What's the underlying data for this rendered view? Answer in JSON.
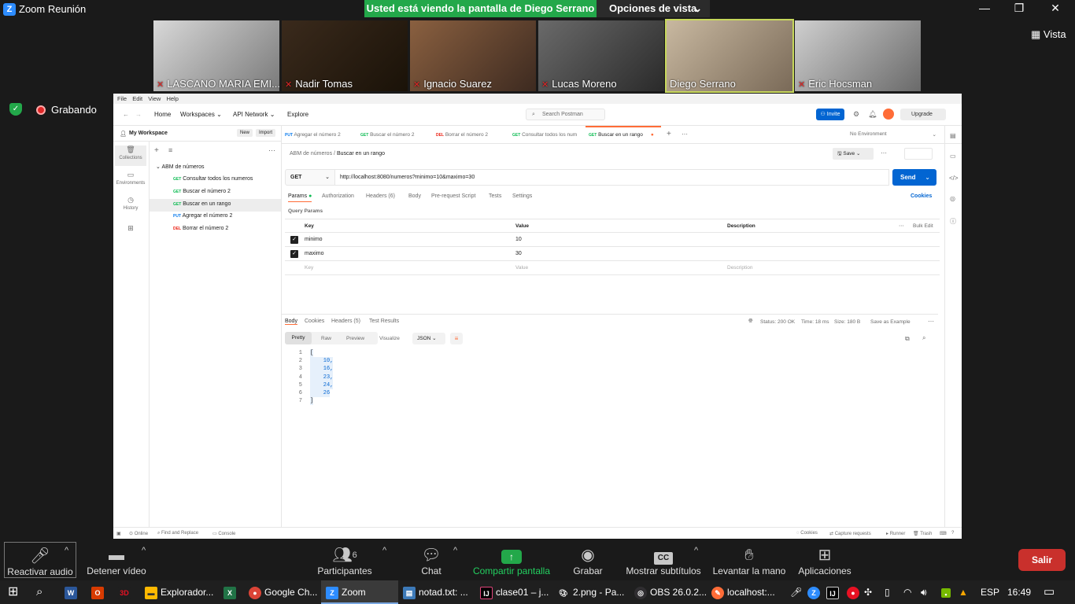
{
  "zoom": {
    "title": "Zoom Reunión",
    "banner": "Usted está viendo la pantalla de Diego Serrano",
    "view_options": "Opciones de vista",
    "vista": "Vista",
    "recording": "Grabando",
    "participants": [
      {
        "name": "LASCANO MARIA EMI...",
        "muted": true
      },
      {
        "name": "Nadir Tomas",
        "muted": true
      },
      {
        "name": "Ignacio Suarez",
        "muted": true
      },
      {
        "name": "Lucas Moreno",
        "muted": true
      },
      {
        "name": "Diego Serrano",
        "muted": false
      },
      {
        "name": "Eric Hocsman",
        "muted": true
      }
    ],
    "bottom": {
      "audio": "Reactivar audio",
      "video": "Detener vídeo",
      "participants": "Participantes",
      "participants_count": "6",
      "chat": "Chat",
      "share": "Compartir pantalla",
      "record": "Grabar",
      "subtitles": "Mostrar subtítulos",
      "hand": "Levantar la mano",
      "apps": "Aplicaciones",
      "leave": "Salir"
    }
  },
  "postman": {
    "menu": [
      "File",
      "Edit",
      "View",
      "Help"
    ],
    "nav": {
      "home": "Home",
      "workspaces": "Workspaces",
      "api_network": "API Network",
      "explore": "Explore"
    },
    "search_placeholder": "Search Postman",
    "invite": "Invite",
    "upgrade": "Upgrade",
    "workspace": "My Workspace",
    "new_btn": "New",
    "import_btn": "Import",
    "rail": [
      "Collections",
      "Environments",
      "History"
    ],
    "collection": "ABM de números",
    "requests": [
      {
        "method": "GET",
        "name": "Consultar todos los numeros"
      },
      {
        "method": "GET",
        "name": "Buscar el número 2"
      },
      {
        "method": "GET",
        "name": "Buscar en un rango"
      },
      {
        "method": "PUT",
        "name": "Agregar el número 2"
      },
      {
        "method": "DEL",
        "name": "Borrar el número 2"
      }
    ],
    "tabs": [
      {
        "method": "PUT",
        "name": "Agregar el número 2"
      },
      {
        "method": "GET",
        "name": "Buscar el número 2"
      },
      {
        "method": "DEL",
        "name": "Borrar el número 2"
      },
      {
        "method": "GET",
        "name": "Consultar todos los num"
      },
      {
        "method": "GET",
        "name": "Buscar en un rango"
      }
    ],
    "environment": "No Environment",
    "breadcrumb_parent": "ABM de números",
    "breadcrumb_current": "Buscar en un rango",
    "save": "Save",
    "method": "GET",
    "url": "http://localhost:8080/numeros?minimo=10&maximo=30",
    "send": "Send",
    "req_tabs": [
      "Params",
      "Authorization",
      "Headers (6)",
      "Body",
      "Pre-request Script",
      "Tests",
      "Settings"
    ],
    "cookies": "Cookies",
    "query_params": "Query Params",
    "col_key": "Key",
    "col_value": "Value",
    "col_desc": "Description",
    "bulk_edit": "Bulk Edit",
    "params": [
      {
        "key": "minimo",
        "value": "10"
      },
      {
        "key": "maximo",
        "value": "30"
      }
    ],
    "placeholder_key": "Key",
    "placeholder_value": "Value",
    "placeholder_desc": "Description",
    "resp_tabs": [
      "Body",
      "Cookies",
      "Headers (5)",
      "Test Results"
    ],
    "status": "Status: 200 OK",
    "time": "Time: 18 ms",
    "size": "Size: 180 B",
    "save_example": "Save as Example",
    "view_modes": [
      "Pretty",
      "Raw",
      "Preview",
      "Visualize"
    ],
    "format": "JSON",
    "response_lines": [
      "[",
      "    10,",
      "    16,",
      "    23,",
      "    24,",
      "    26",
      "]"
    ],
    "footer": {
      "online": "Online",
      "find": "Find and Replace",
      "console": "Console",
      "cookies": "Cookies",
      "capture": "Capture requests",
      "runner": "Runner",
      "trash": "Trash"
    }
  },
  "taskbar": {
    "apps": [
      "Explorador...",
      "Google Ch...",
      "Zoom",
      "notad.txt: ...",
      "clase01 – j...",
      "2.png - Pa...",
      "OBS 26.0.2...",
      "localhost:..."
    ],
    "lang": "ESP",
    "time": "16:49"
  }
}
